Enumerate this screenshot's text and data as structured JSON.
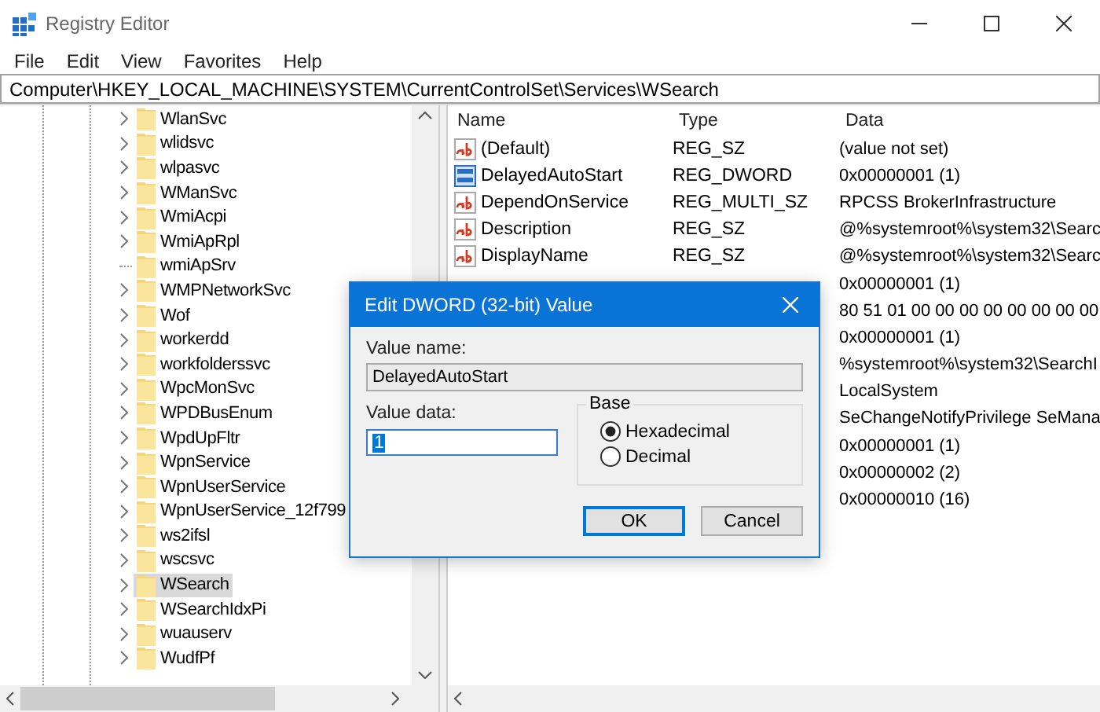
{
  "window": {
    "title": "Registry Editor"
  },
  "menu": [
    "File",
    "Edit",
    "View",
    "Favorites",
    "Help"
  ],
  "address": "Computer\\HKEY_LOCAL_MACHINE\\SYSTEM\\CurrentControlSet\\Services\\WSearch",
  "tree": {
    "items": [
      {
        "label": "WlanSvc",
        "expandable": true,
        "selected": false
      },
      {
        "label": "wlidsvc",
        "expandable": true,
        "selected": false
      },
      {
        "label": "wlpasvc",
        "expandable": true,
        "selected": false
      },
      {
        "label": "WManSvc",
        "expandable": true,
        "selected": false
      },
      {
        "label": "WmiAcpi",
        "expandable": true,
        "selected": false
      },
      {
        "label": "WmiApRpl",
        "expandable": true,
        "selected": false
      },
      {
        "label": "wmiApSrv",
        "expandable": false,
        "selected": false
      },
      {
        "label": "WMPNetworkSvc",
        "expandable": true,
        "selected": false
      },
      {
        "label": "Wof",
        "expandable": true,
        "selected": false
      },
      {
        "label": "workerdd",
        "expandable": true,
        "selected": false
      },
      {
        "label": "workfolderssvc",
        "expandable": true,
        "selected": false
      },
      {
        "label": "WpcMonSvc",
        "expandable": true,
        "selected": false
      },
      {
        "label": "WPDBusEnum",
        "expandable": true,
        "selected": false
      },
      {
        "label": "WpdUpFltr",
        "expandable": true,
        "selected": false
      },
      {
        "label": "WpnService",
        "expandable": true,
        "selected": false
      },
      {
        "label": "WpnUserService",
        "expandable": true,
        "selected": false
      },
      {
        "label": "WpnUserService_12f799",
        "expandable": true,
        "selected": false
      },
      {
        "label": "ws2ifsl",
        "expandable": true,
        "selected": false
      },
      {
        "label": "wscsvc",
        "expandable": true,
        "selected": false
      },
      {
        "label": "WSearch",
        "expandable": true,
        "selected": true
      },
      {
        "label": "WSearchIdxPi",
        "expandable": true,
        "selected": false
      },
      {
        "label": "wuauserv",
        "expandable": true,
        "selected": false
      },
      {
        "label": "WudfPf",
        "expandable": true,
        "selected": false
      }
    ]
  },
  "list": {
    "columns": [
      "Name",
      "Type",
      "Data"
    ],
    "rows": [
      {
        "kind": "string",
        "name": "(Default)",
        "type": "REG_SZ",
        "data": "(value not set)"
      },
      {
        "kind": "dword",
        "name": "DelayedAutoStart",
        "type": "REG_DWORD",
        "data": "0x00000001 (1)"
      },
      {
        "kind": "string",
        "name": "DependOnService",
        "type": "REG_MULTI_SZ",
        "data": "RPCSS BrokerInfrastructure"
      },
      {
        "kind": "string",
        "name": "Description",
        "type": "REG_SZ",
        "data": "@%systemroot%\\system32\\Searc"
      },
      {
        "kind": "string",
        "name": "DisplayName",
        "type": "REG_SZ",
        "data": "@%systemroot%\\system32\\Searc"
      },
      {
        "data": "0x00000001 (1)"
      },
      {
        "data": "80 51 01 00 00 00 00 00 00 00 00"
      },
      {
        "data": "0x00000001 (1)"
      },
      {
        "data": "%systemroot%\\system32\\SearchI"
      },
      {
        "data": "LocalSystem"
      },
      {
        "data": "SeChangeNotifyPrivilege SeMana"
      },
      {
        "data": "0x00000001 (1)"
      },
      {
        "data": "0x00000002 (2)"
      },
      {
        "data": "0x00000010 (16)"
      }
    ]
  },
  "dialog": {
    "title": "Edit DWORD (32-bit) Value",
    "value_name_label": "Value name:",
    "value_name": "DelayedAutoStart",
    "value_data_label": "Value data:",
    "value_data": "1",
    "value_data_selected": true,
    "base_label": "Base",
    "radios": [
      {
        "label": "Hexadecimal",
        "selected": true
      },
      {
        "label": "Decimal",
        "selected": false
      }
    ],
    "buttons": [
      {
        "label": "OK",
        "default": true
      },
      {
        "label": "Cancel",
        "default": false
      }
    ]
  }
}
